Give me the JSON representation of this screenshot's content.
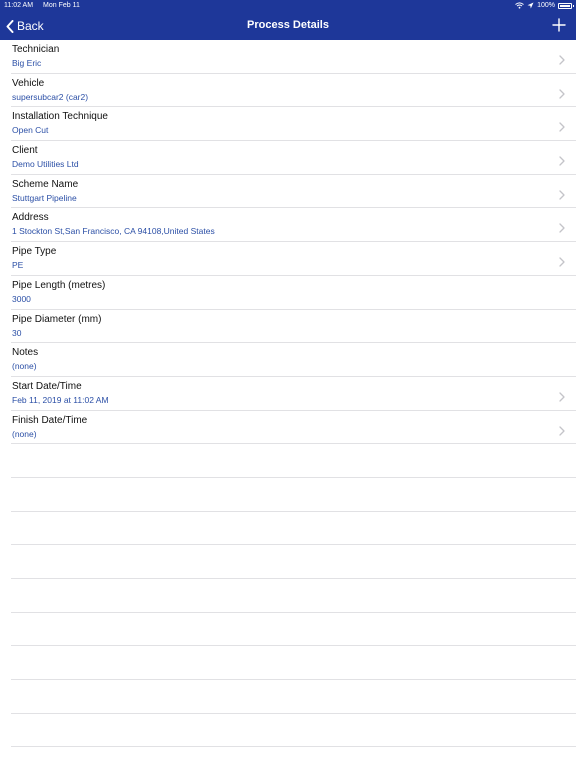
{
  "status": {
    "time": "11:02 AM",
    "date": "Mon Feb 11",
    "battery": "100%"
  },
  "nav": {
    "back_label": "Back",
    "title": "Process Details",
    "add_icon": "plus-icon"
  },
  "colors": {
    "nav_background": "#1e3799",
    "value_text": "#2b4fa6",
    "separator": "#e1e1e4"
  },
  "rows": [
    {
      "label": "Technician",
      "value": "Big Eric",
      "disclosure": true
    },
    {
      "label": "Vehicle",
      "value": "supersubcar2 (car2)",
      "disclosure": true
    },
    {
      "label": "Installation Technique",
      "value": "Open Cut",
      "disclosure": true
    },
    {
      "label": "Client",
      "value": "Demo Utilities Ltd",
      "disclosure": true
    },
    {
      "label": "Scheme Name",
      "value": "Stuttgart Pipeline",
      "disclosure": true
    },
    {
      "label": "Address",
      "value": "1 Stockton St,San Francisco, CA  94108,United States",
      "disclosure": true
    },
    {
      "label": "Pipe Type",
      "value": "PE",
      "disclosure": true
    },
    {
      "label": "Pipe Length (metres)",
      "value": "3000",
      "disclosure": false
    },
    {
      "label": "Pipe Diameter (mm)",
      "value": "30",
      "disclosure": false
    },
    {
      "label": "Notes",
      "value": "(none)",
      "disclosure": false
    },
    {
      "label": "Start Date/Time",
      "value": "Feb 11, 2019 at 11:02 AM",
      "disclosure": true
    },
    {
      "label": "Finish Date/Time",
      "value": "(none)",
      "disclosure": true
    }
  ]
}
